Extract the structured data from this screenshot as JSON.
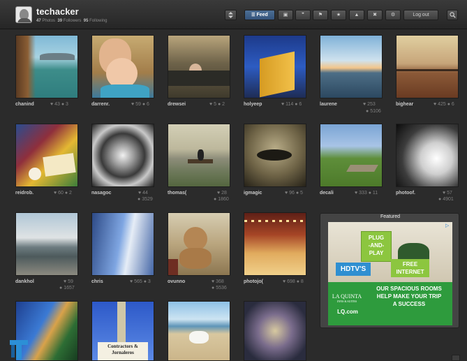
{
  "header": {
    "username": "techacker",
    "stats": {
      "photos_count": "47",
      "photos_label": "Photos",
      "followers_count": "39",
      "followers_label": "Followers",
      "following_count": "95",
      "following_label": "Following"
    },
    "buttons": {
      "sort_icon": "sort-icon",
      "feed": "Feed",
      "logout": "Log out",
      "search_icon": "search-icon"
    }
  },
  "grid": [
    {
      "user": "chanind",
      "likes": "43",
      "comments": "3"
    },
    {
      "user": "darrenr.",
      "likes": "59",
      "comments": "6"
    },
    {
      "user": "drewsei",
      "likes": "5",
      "comments": "2"
    },
    {
      "user": "holyeep",
      "likes": "114",
      "comments": "6"
    },
    {
      "user": "laurene",
      "likes": "253",
      "comments": "5106"
    },
    {
      "user": "bighear",
      "likes": "425",
      "comments": "6"
    },
    {
      "user": "reidrob.",
      "likes": "60",
      "comments": "2"
    },
    {
      "user": "nasagoc",
      "likes": "44",
      "comments": "3529"
    },
    {
      "user": "thomas(",
      "likes": "28",
      "comments": "1860"
    },
    {
      "user": "igmagic",
      "likes": "96",
      "comments": "5"
    },
    {
      "user": "decali",
      "likes": "333",
      "comments": "11"
    },
    {
      "user": "photoof.",
      "likes": "57",
      "comments": "4901"
    },
    {
      "user": "dankhol",
      "likes": "59",
      "comments": "1657"
    },
    {
      "user": "chris",
      "likes": "565",
      "comments": "3"
    },
    {
      "user": "ovunno",
      "likes": "368",
      "comments": "5536"
    },
    {
      "user": "photojo(",
      "likes": "698",
      "comments": "8"
    }
  ],
  "featured": {
    "title": "Featured",
    "ad": {
      "plug": "PLUG",
      "and": "-AND-",
      "play": "PLAY",
      "hdtv": "HDTV'S",
      "free": "FREE",
      "internet": "INTERNET",
      "line1": "OUR SPACIOUS ROOMS",
      "line2": "HELP MAKE YOUR TRIP",
      "line3": "A SUCCESS",
      "brand": "LA QUINTA",
      "brand_sub": "INNS & SUITES",
      "url": "LQ.com"
    }
  },
  "bottom_sign": {
    "line1": "Contractors &",
    "line2": "Jornaleros"
  }
}
